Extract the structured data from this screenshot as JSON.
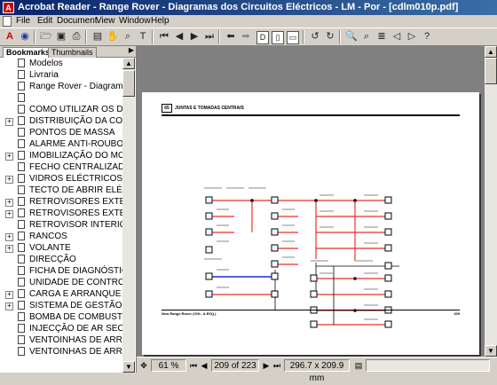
{
  "window": {
    "title": "Acrobat Reader - Range Rover - Diagramas dos Circuitos Eléctricos - LM - Por - [cdlm010p.pdf]"
  },
  "menu": {
    "items": [
      "File",
      "Edit",
      "Document",
      "View",
      "Window",
      "Help"
    ]
  },
  "toolbar": {
    "icons": [
      "acrobat-icon",
      "web-icon",
      "open-icon",
      "save-icon",
      "print-icon",
      "show-hide-navigation-icon",
      "hand-tool-icon",
      "zoom-tool-icon",
      "text-select-icon",
      "first-page-icon",
      "previous-page-icon",
      "next-page-icon",
      "last-page-icon",
      "go-back-icon",
      "go-forward-icon",
      "actual-size-icon",
      "fit-page-icon",
      "fit-width-icon",
      "rotate-left-icon",
      "rotate-right-icon",
      "find-icon",
      "search-icon",
      "search-results-icon",
      "previous-highlight-icon",
      "next-highlight-icon",
      "help-icon"
    ]
  },
  "nav_panel": {
    "tabs": [
      "Bookmarks",
      "Thumbnails"
    ],
    "active_tab": "Bookmarks",
    "bookmarks": [
      {
        "label": "Modelos",
        "expandable": false
      },
      {
        "label": "Livraria",
        "expandable": false
      },
      {
        "label": "Range Rover - Diagramas",
        "expandable": false
      },
      {
        "label": "",
        "expandable": false
      },
      {
        "label": "COMO UTILIZAR OS DIAG",
        "expandable": false
      },
      {
        "label": "DISTRIBUIÇÃO DA CORR",
        "expandable": true
      },
      {
        "label": "PONTOS DE MASSA",
        "expandable": false
      },
      {
        "label": "ALARME ANTI-ROUBO",
        "expandable": false
      },
      {
        "label": "IMOBILIZAÇÃO DO MOTOR",
        "expandable": true
      },
      {
        "label": "FECHO CENTRALIZADO",
        "expandable": false
      },
      {
        "label": "VIDROS ELÉCTRICOS",
        "expandable": true
      },
      {
        "label": "TECTO DE ABRIR ELÉCTI",
        "expandable": false
      },
      {
        "label": "RETROVISORES EXTERIO",
        "expandable": true
      },
      {
        "label": "RETROVISORES EXTERIO",
        "expandable": true
      },
      {
        "label": "RETROVISOR INTERIOR",
        "expandable": false
      },
      {
        "label": "RANCOS",
        "expandable": true
      },
      {
        "label": "VOLANTE",
        "expandable": true
      },
      {
        "label": "DIRECÇÃO",
        "expandable": false
      },
      {
        "label": "FICHA DE DIAGNÓSTICO",
        "expandable": false
      },
      {
        "label": "UNIDADE DE CONTROLO",
        "expandable": false
      },
      {
        "label": "CARGA E ARRANQUE",
        "expandable": true
      },
      {
        "label": "SISTEMA DE GESTÃO DO",
        "expandable": true
      },
      {
        "label": "BOMBA DE COMBUSTÍVEL",
        "expandable": false
      },
      {
        "label": "INJECÇÃO DE AR SECUN",
        "expandable": false
      },
      {
        "label": "VENTOINHAS DE ARREFE",
        "expandable": false
      },
      {
        "label": "VENTOINHAS DE ARREFE",
        "expandable": false
      }
    ]
  },
  "document": {
    "page_header_number": "65",
    "page_header_title": "JUNTAS E TOMADAS CENTRAIS",
    "page_footer_left": "New Range Rover (VOL. A ESQ.)",
    "page_footer_right": "209",
    "wire_colors": {
      "red": "#e8322a",
      "blue": "#1a2ad0",
      "black": "#000000"
    }
  },
  "status": {
    "zoom": "61 %",
    "page_indicator": "209 of 223",
    "page_size": "296.7 x 209.9 mm"
  }
}
